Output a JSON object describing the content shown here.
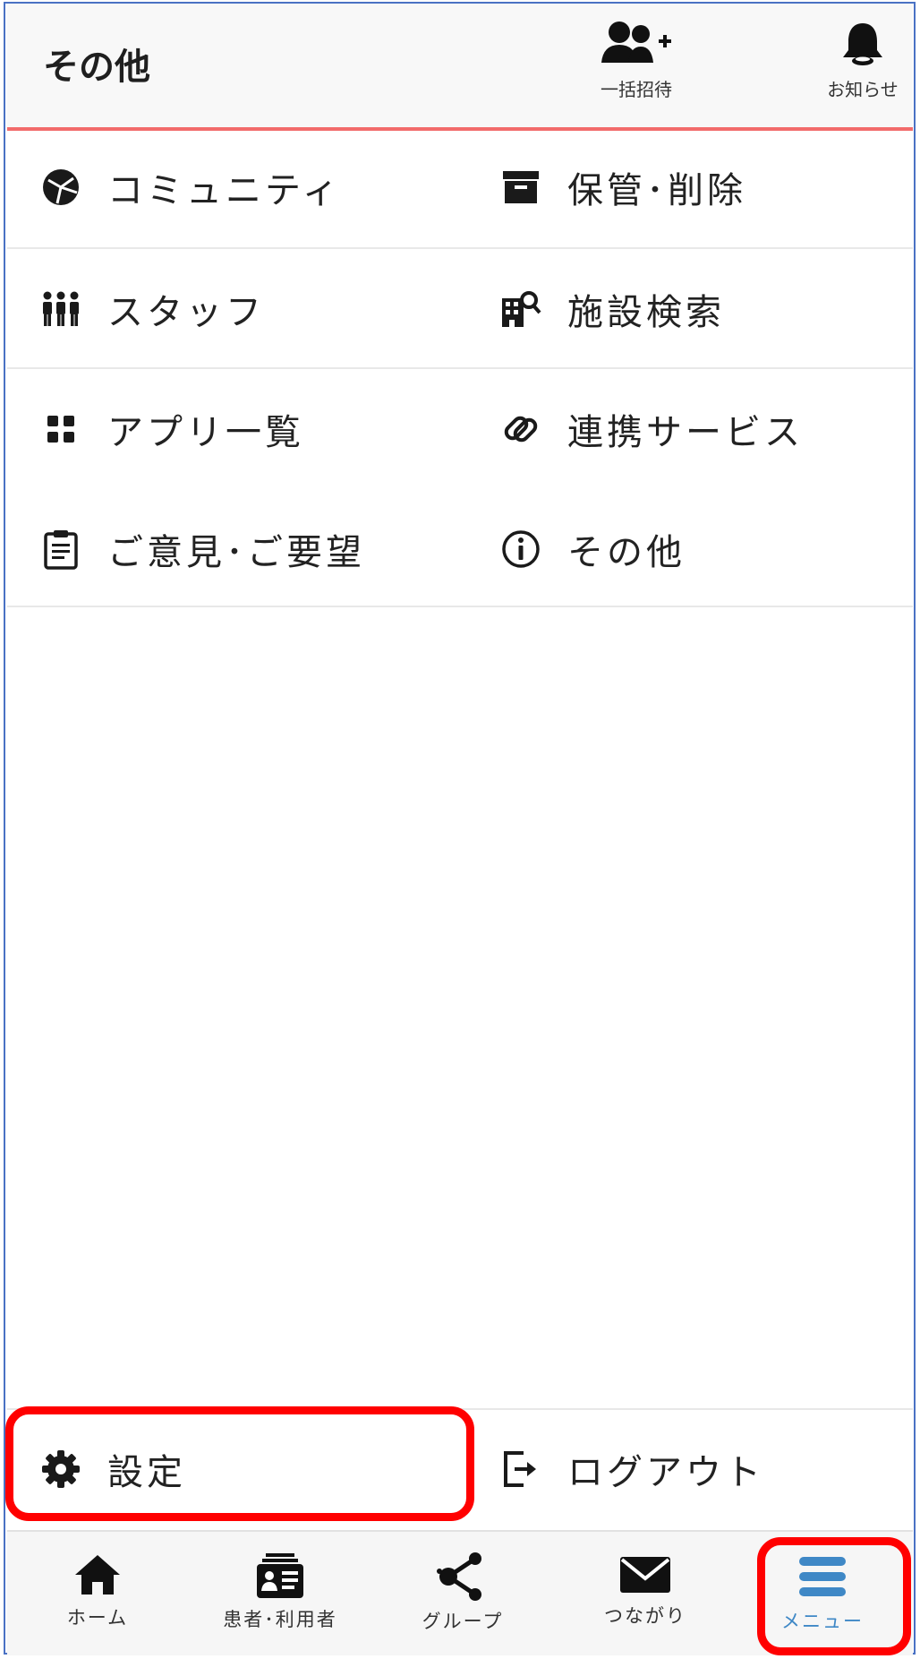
{
  "header": {
    "title": "その他",
    "bulk_invite_label": "一括招待",
    "notifications_label": "お知らせ"
  },
  "menu": {
    "community": "コミュニティ",
    "archive_delete": "保管･削除",
    "staff": "スタッフ",
    "facility_search": "施設検索",
    "app_list": "アプリ一覧",
    "linked_services": "連携サービス",
    "feedback": "ご意見･ご要望",
    "other": "その他"
  },
  "footer_actions": {
    "settings": "設定",
    "logout": "ログアウト"
  },
  "bottom_nav": {
    "home": "ホーム",
    "patients": "患者･利用者",
    "groups": "グループ",
    "connections": "つながり",
    "menu": "メニュー"
  },
  "colors": {
    "accent_line": "#f26b6b",
    "active_nav": "#3f88c6",
    "highlight": "#ff0000",
    "frame": "#4a72c4"
  }
}
